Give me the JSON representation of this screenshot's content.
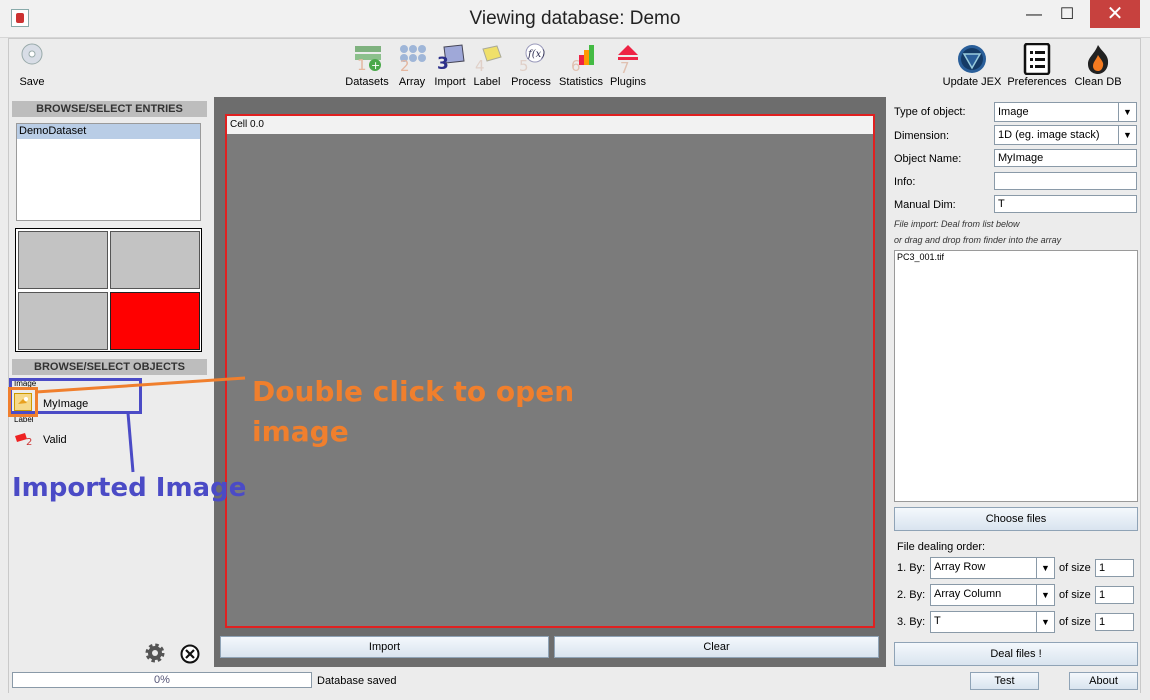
{
  "window": {
    "title": "Viewing database: Demo",
    "minimize": "—",
    "maximize": "☐",
    "close": "✕"
  },
  "toolbar": {
    "save": "Save",
    "items": [
      {
        "label": "Datasets",
        "num": "1"
      },
      {
        "label": "Array",
        "num": "2"
      },
      {
        "label": "Import",
        "num": "3"
      },
      {
        "label": "Label",
        "num": "4"
      },
      {
        "label": "Process",
        "num": "5"
      },
      {
        "label": "Statistics",
        "num": "6"
      },
      {
        "label": "Plugins",
        "num": "7"
      }
    ],
    "right": [
      "Update JEX",
      "Preferences",
      "Clean DB"
    ]
  },
  "left": {
    "entries_header": "BROWSE/SELECT ENTRIES",
    "entries": [
      "DemoDataset"
    ],
    "objects_header": "BROWSE/SELECT OBJECTS",
    "objects": [
      {
        "group": "Image",
        "name": "MyImage"
      },
      {
        "group": "Label",
        "name": "Valid"
      }
    ]
  },
  "center": {
    "cell_label": "Cell 0.0",
    "import_button": "Import",
    "clear_button": "Clear"
  },
  "right": {
    "type_label": "Type of object:",
    "type_value": "Image",
    "dim_label": "Dimension:",
    "dim_value": "1D (eg. image stack)",
    "name_label": "Object Name:",
    "name_value": "MyImage",
    "info_label": "Info:",
    "info_value": "",
    "manual_label": "Manual Dim:",
    "manual_value": "T",
    "hint1": "File import: Deal from list below",
    "hint2": "or drag and drop from finder into the array",
    "files": [
      "PC3_001.tif"
    ],
    "choose_button": "Choose files",
    "order_label": "File dealing order:",
    "order": [
      {
        "by": "1. By:",
        "value": "Array Row",
        "of": "of size",
        "size": "1"
      },
      {
        "by": "2. By:",
        "value": "Array Column",
        "of": "of size",
        "size": "1"
      },
      {
        "by": "3. By:",
        "value": "T",
        "of": "of size",
        "size": "1"
      }
    ],
    "deal_button": "Deal files !"
  },
  "status": {
    "progress": "0%",
    "progress_value": 0,
    "message": "Database saved",
    "test": "Test",
    "about": "About"
  },
  "annotations": {
    "double_click_1": "Double click to open",
    "double_click_2": "image",
    "imported": "Imported Image"
  },
  "colors": {
    "orange": "#f07f2d",
    "blue": "#4b4bc6",
    "selected": "#b9cde6",
    "red_cell": "#ff0000"
  }
}
